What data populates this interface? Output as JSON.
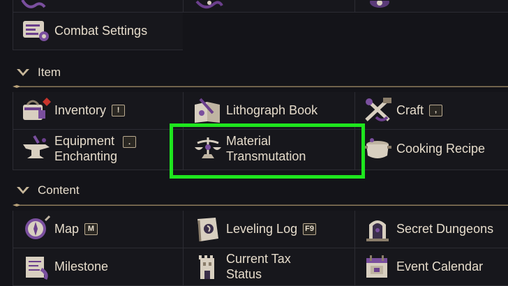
{
  "top": {
    "combat_settings": "Combat Settings"
  },
  "sections": {
    "item": {
      "title": "Item",
      "inventory": {
        "label": "Inventory",
        "key": "!"
      },
      "lithograph": {
        "label": "Lithograph Book"
      },
      "craft": {
        "label": "Craft",
        "key": ","
      },
      "equip": {
        "line1": "Equipment",
        "line2": "Enchanting",
        "key": "."
      },
      "material": {
        "line1": "Material",
        "line2": "Transmutation"
      },
      "cooking": {
        "label": "Cooking Recipe"
      }
    },
    "content": {
      "title": "Content",
      "map": {
        "label": "Map",
        "key": "M"
      },
      "leveling": {
        "label": "Leveling Log",
        "key": "F9"
      },
      "secret": {
        "label": "Secret Dungeons"
      },
      "milestone": {
        "label": "Milestone"
      },
      "tax": {
        "line1": "Current Tax",
        "line2": "Status"
      },
      "event": {
        "label": "Event Calendar"
      }
    }
  },
  "colors": {
    "highlight": "#1ee61e",
    "text": "#e6dccb",
    "accent_purple": "#6b3f8c",
    "gold": "#b9a279"
  }
}
